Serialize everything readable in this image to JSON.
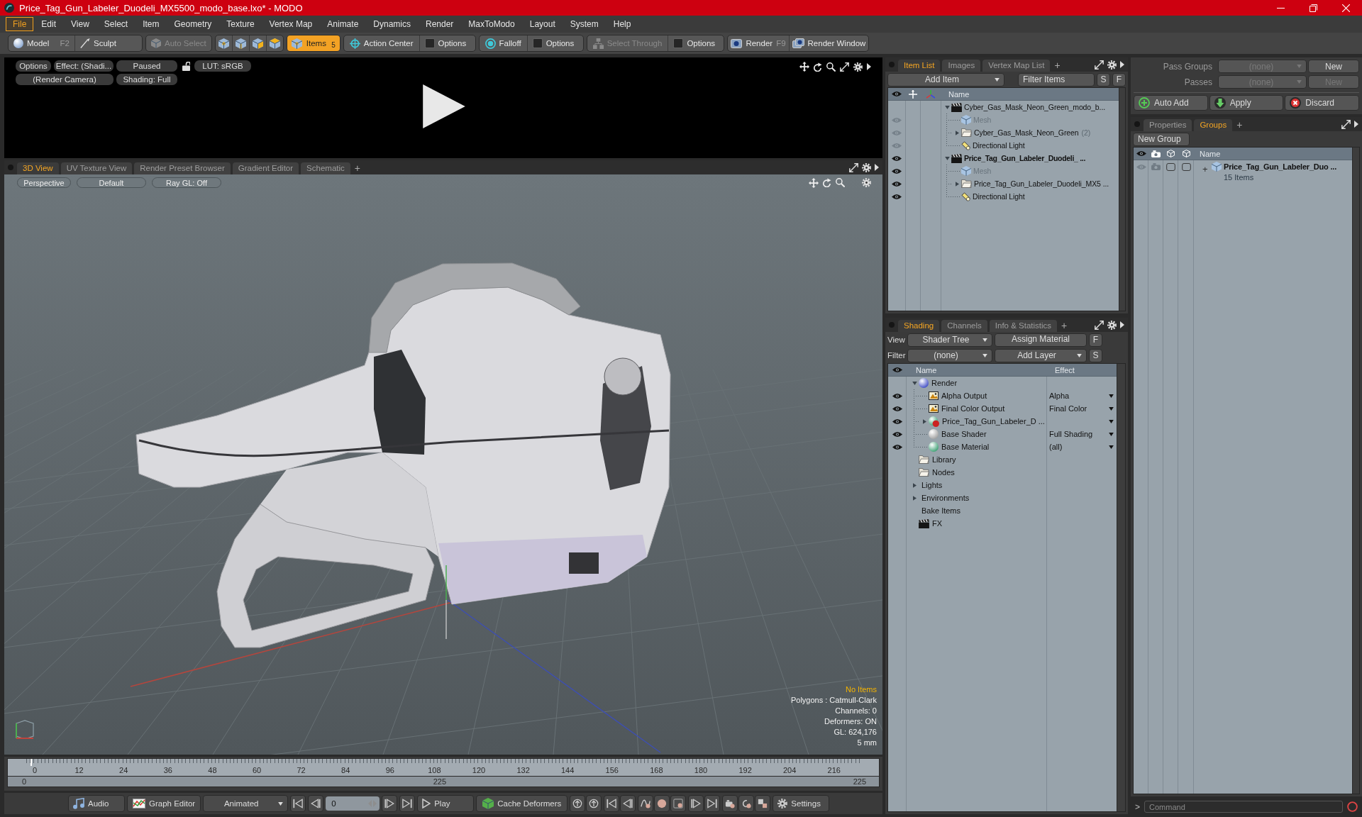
{
  "window": {
    "title": "Price_Tag_Gun_Labeler_Duodeli_MX5500_modo_base.lxo* - MODO"
  },
  "menu": [
    {
      "label": "File",
      "selected": true
    },
    {
      "label": "Edit",
      "selected": false
    },
    {
      "label": "View",
      "selected": false
    },
    {
      "label": "Select",
      "selected": false
    },
    {
      "label": "Item",
      "selected": false
    },
    {
      "label": "Geometry",
      "selected": false
    },
    {
      "label": "Texture",
      "selected": false
    },
    {
      "label": "Vertex Map",
      "selected": false
    },
    {
      "label": "Animate",
      "selected": false
    },
    {
      "label": "Dynamics",
      "selected": false
    },
    {
      "label": "Render",
      "selected": false
    },
    {
      "label": "MaxToModo",
      "selected": false
    },
    {
      "label": "Layout",
      "selected": false
    },
    {
      "label": "System",
      "selected": false
    },
    {
      "label": "Help",
      "selected": false
    }
  ],
  "toolbar": {
    "modes": [
      {
        "label": "Model",
        "shortcut": "F2"
      },
      {
        "label": "Sculpt"
      }
    ],
    "auto_select": {
      "label": "Auto Select",
      "disabled": true
    },
    "selection_modes": [
      {
        "selected": false
      },
      {
        "selected": false
      },
      {
        "selected": false
      },
      {
        "selected": false
      },
      {
        "label": "Items",
        "count": "5",
        "selected": true
      }
    ],
    "tools": [
      {
        "label": "Action Center",
        "disabled": false
      },
      {
        "label": "Options",
        "disabled": false
      },
      {
        "label": "Falloff",
        "disabled": false
      },
      {
        "label": "Options",
        "disabled": false
      },
      {
        "label": "Select Through",
        "disabled": true
      },
      {
        "label": "Options",
        "disabled": false
      }
    ],
    "render": [
      {
        "label": "Render",
        "shortcut": "F9"
      },
      {
        "label": "Render Window"
      }
    ]
  },
  "render_preview": {
    "row_1": [
      "Options",
      "Effect: (Shadi...",
      "Paused"
    ],
    "lut": "LUT: sRGB",
    "row_2": [
      "(Render Camera)",
      "Shading: Full"
    ]
  },
  "viewport": {
    "tabs": [
      {
        "label": "3D View",
        "selected": true
      },
      {
        "label": "UV Texture View",
        "selected": false
      },
      {
        "label": "Render Preset Browser",
        "selected": false
      },
      {
        "label": "Gradient Editor",
        "selected": false
      },
      {
        "label": "Schematic",
        "selected": false
      }
    ],
    "add_tab": "+",
    "buttons": [
      "Perspective",
      "Default",
      "Ray GL: Off"
    ],
    "info": {
      "status": "No Items",
      "lines": [
        "Polygons : Catmull-Clark",
        "Channels: 0",
        "Deformers: ON",
        "GL: 624,176",
        "5 mm"
      ]
    }
  },
  "timeline": {
    "ticks": [
      "0",
      "12",
      "24",
      "36",
      "48",
      "60",
      "72",
      "84",
      "96",
      "108",
      "120",
      "132",
      "144",
      "156",
      "168",
      "180",
      "192",
      "204",
      "216"
    ],
    "range": [
      "0",
      "225",
      "225"
    ]
  },
  "transport": {
    "audio": "Audio",
    "graph_editor": "Graph Editor",
    "mode": "Animated",
    "frame": "0",
    "play": "Play",
    "cache": "Cache Deformers",
    "settings": "Settings"
  },
  "item_list": {
    "tabs": [
      {
        "label": "Item List",
        "selected": true
      },
      {
        "label": "Images",
        "selected": false
      },
      {
        "label": "Vertex Map List",
        "selected": false
      }
    ],
    "add_tab": "+",
    "add_item": "Add Item",
    "filter": "Filter Items",
    "toggles": [
      "S",
      "F"
    ],
    "name_header": "Name",
    "items": [
      {
        "name": "Cyber_Gas_Mask_Neon_Green_modo_b...",
        "kind": "scene",
        "eye": false,
        "current": false,
        "dimmed": false,
        "expanded": true,
        "children": [
          {
            "name": "Mesh",
            "kind": "mesh",
            "eye": true,
            "eye_dim": true,
            "current": false,
            "dimmed": true
          },
          {
            "name": "Cyber_Gas_Mask_Neon_Green",
            "count": "(2)",
            "kind": "group",
            "eye": true,
            "eye_dim": true,
            "current": false,
            "dimmed": false,
            "expanded": false
          },
          {
            "name": "Directional Light",
            "kind": "light",
            "eye": true,
            "eye_dim": true,
            "current": false,
            "dimmed": false
          }
        ]
      },
      {
        "name": "Price_Tag_Gun_Labeler_Duodeli_ ...",
        "kind": "scene",
        "eye": true,
        "eye_dim": false,
        "current": true,
        "dimmed": false,
        "expanded": true,
        "children": [
          {
            "name": "Mesh",
            "kind": "mesh",
            "eye": true,
            "eye_dim": false,
            "current": false,
            "dimmed": true
          },
          {
            "name": "Price_Tag_Gun_Labeler_Duodeli_MX5 ...",
            "kind": "group",
            "eye": true,
            "eye_dim": false,
            "current": false,
            "dimmed": false,
            "expanded": false
          },
          {
            "name": "Directional Light",
            "kind": "light",
            "eye": true,
            "eye_dim": false,
            "current": false,
            "dimmed": false
          }
        ]
      }
    ]
  },
  "shading": {
    "tabs": [
      {
        "label": "Shading",
        "selected": true
      },
      {
        "label": "Channels",
        "selected": false
      },
      {
        "label": "Info & Statistics",
        "selected": false
      }
    ],
    "add_tab": "+",
    "view_label": "View",
    "view": "Shader Tree",
    "assign": "Assign Material",
    "assign_toggle": "F",
    "filter_label": "Filter",
    "filter": "(none)",
    "add_layer": "Add Layer",
    "layer_toggle": "S",
    "headers": [
      "Name",
      "Effect"
    ],
    "items": [
      {
        "name": "Render",
        "kind": "render",
        "eye": false,
        "expanded": true,
        "children": [
          {
            "name": "Alpha Output",
            "kind": "output",
            "eye": true,
            "effect": "Alpha"
          },
          {
            "name": "Final Color Output",
            "kind": "output",
            "eye": true,
            "effect": "Final Color"
          },
          {
            "name": "Price_Tag_Gun_Labeler_D ...",
            "kind": "material_group",
            "eye": true,
            "expanded": false
          },
          {
            "name": "Base Shader",
            "kind": "shader",
            "eye": true,
            "effect": "Full Shading"
          },
          {
            "name": "Base Material",
            "kind": "material",
            "eye": true,
            "effect": "(all)"
          }
        ]
      },
      {
        "name": "Library",
        "kind": "folder",
        "eye": false
      },
      {
        "name": "Nodes",
        "kind": "folder",
        "eye": false
      },
      {
        "name": "Lights",
        "kind": "none",
        "eye": false,
        "expanded": false
      },
      {
        "name": "Environments",
        "kind": "none",
        "eye": false,
        "expanded": false
      },
      {
        "name": "Bake Items",
        "kind": "none",
        "eye": false
      },
      {
        "name": "FX",
        "kind": "fx",
        "eye": false
      }
    ]
  },
  "passes": {
    "rows": [
      {
        "label": "Pass Groups",
        "value": "(none)",
        "button": "New",
        "disabled": false
      },
      {
        "label": "Passes",
        "value": "(none)",
        "button": "New",
        "disabled": true
      }
    ],
    "actions": [
      "Auto Add",
      "Apply",
      "Discard"
    ]
  },
  "groups": {
    "tabs": [
      {
        "label": "Properties",
        "selected": false
      },
      {
        "label": "Groups",
        "selected": true
      }
    ],
    "add_tab": "+",
    "new_group": "New Group",
    "name_header": "Name",
    "items": [
      {
        "name": "Price_Tag_Gun_Labeler_Duo ...",
        "count": "15 Items",
        "toggle": "+",
        "eye": true,
        "eye_dim": true
      }
    ]
  },
  "command": {
    "prompt": ">",
    "placeholder": "Command"
  }
}
